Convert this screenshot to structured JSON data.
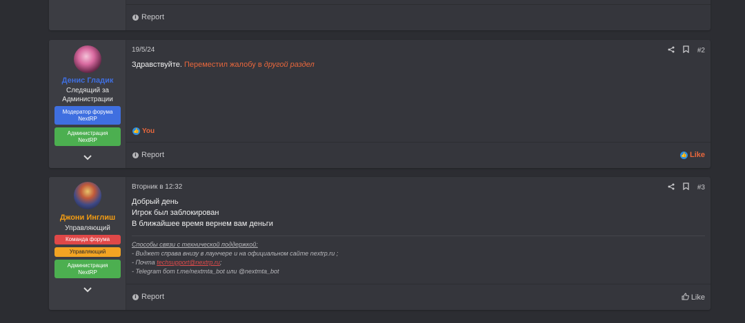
{
  "post0": {
    "report_label": "Report"
  },
  "post1": {
    "author": {
      "name": "Денис Гладик",
      "title_line1": "Следящий за",
      "title_line2": "Администрации"
    },
    "badges": [
      {
        "line1": "Модератор форума",
        "line2": "NextRP",
        "color": "#3f6fe0"
      },
      {
        "line1": "Администрация",
        "line2": "NextRP",
        "color": "#4caf50"
      }
    ],
    "date": "19/5/24",
    "number": "#2",
    "text_plain": "Здравствуйте.",
    "text_link_plain": "Переместил жалобу в",
    "text_link_italic": "другой раздел",
    "reaction_user": "You",
    "report_label": "Report",
    "like_label": "Like"
  },
  "post2": {
    "author": {
      "name": "Джони Инглиш",
      "title": "Управляющий"
    },
    "badges": [
      {
        "line1": "Команда форума",
        "line2": "",
        "color": "#e04848"
      },
      {
        "line1": "Управляющий",
        "line2": "",
        "color": "#f3a423"
      },
      {
        "line1": "Администрация",
        "line2": "NextRP",
        "color": "#4caf50"
      }
    ],
    "date": "Вторник в 12:32",
    "number": "#3",
    "lines": [
      "Добрый день",
      "Игрок был заблокирован",
      "В ближайшее время вернем вам деньги"
    ],
    "signature": {
      "heading": "Способы связи с технической поддержкой:",
      "line1": "- Виджет справа внизу в лаунчере и на официальном сайте nextrp.ru ;",
      "line2_prefix": "- Почта ",
      "line2_email": "techsupport@nextrp.ru",
      "line2_suffix": ";",
      "line3": "- Telegram бот t.me/nextmta_bot или @nextmta_bot"
    },
    "report_label": "Report",
    "like_label": "Like"
  },
  "colors": {
    "accent": "#e8673c",
    "name_blue": "#3f6fe0",
    "name_orange": "#f39c12",
    "bg": "#2c2d32",
    "card": "#35363c"
  },
  "icons": {
    "share": "share-icon",
    "bookmark": "bookmark-icon",
    "info": "info-icon",
    "like": "thumbs-up-icon",
    "expand": "chevron-down-icon"
  }
}
